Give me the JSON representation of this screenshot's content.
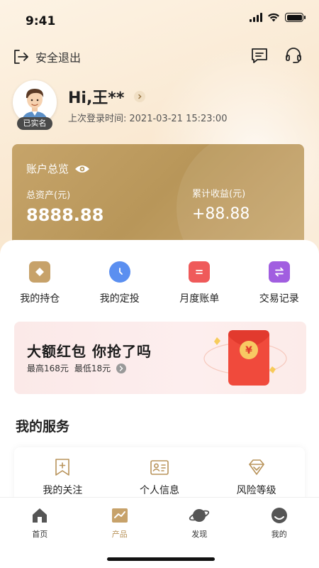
{
  "status_bar": {
    "time": "9:41"
  },
  "header": {
    "logout_label": "安全退出"
  },
  "profile": {
    "greeting": "Hi,王**",
    "verified_badge": "已实名",
    "last_login_label": "上次登录时间:",
    "last_login_time": "2021-03-21 15:23:00"
  },
  "account_card": {
    "title": "账户总览",
    "total_assets_label": "总资产(元)",
    "total_assets_value": "8888.88",
    "cumulative_income_label": "累计收益(元)",
    "cumulative_income_value": "+88.88"
  },
  "quick_actions": [
    {
      "label": "我的持仓",
      "icon": "holdings-icon",
      "color": "#b8935a"
    },
    {
      "label": "我的定投",
      "icon": "clock-icon",
      "color": "#5b8ff0"
    },
    {
      "label": "月度账单",
      "icon": "bill-icon",
      "color": "#ef5a5a"
    },
    {
      "label": "交易记录",
      "icon": "exchange-icon",
      "color": "#a15ee0"
    }
  ],
  "promo": {
    "title": "大额红包 你抢了吗",
    "max_text": "最高168元",
    "min_text": "最低18元"
  },
  "services": {
    "title": "我的服务",
    "items": [
      {
        "label": "我的关注",
        "icon": "bookmark-add-icon"
      },
      {
        "label": "个人信息",
        "icon": "id-card-icon"
      },
      {
        "label": "风险等级",
        "icon": "diamond-icon"
      }
    ]
  },
  "tab_bar": {
    "tabs": [
      {
        "label": "首页",
        "icon": "home-icon"
      },
      {
        "label": "产品",
        "icon": "chart-icon",
        "active": true
      },
      {
        "label": "发现",
        "icon": "planet-icon"
      },
      {
        "label": "我的",
        "icon": "profile-icon"
      }
    ]
  },
  "colors": {
    "gold": "#b8935a",
    "card_gold": "#c6a46a",
    "promo_red": "#f04a3c"
  }
}
